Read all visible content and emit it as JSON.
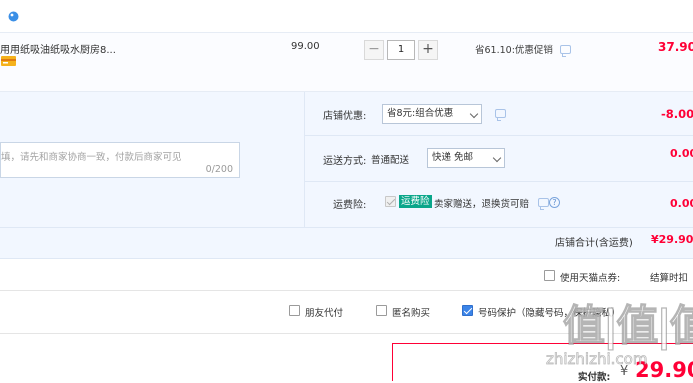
{
  "item": {
    "title": "用用纸吸油纸吸水厨房8...",
    "unit_price": "99.00",
    "quantity": "1",
    "minus_symbol": "−",
    "plus_symbol": "+",
    "promo_text": "省61.10:优惠促销",
    "subtotal": "37.90"
  },
  "shop": {
    "message_placeholder": "填，请先和商家协商一致，付款后商家可见",
    "message_counter": "0/200",
    "discount_label": "店铺优惠:",
    "discount_select": "省8元:组合优惠",
    "discount_amount": "-8.00",
    "delivery_label": "运送方式:",
    "delivery_type": "普通配送",
    "delivery_select": "快递 免邮",
    "delivery_amount": "0.00",
    "insurance_label": "运费险:",
    "insurance_badge": "运费险",
    "insurance_text": "卖家赠送，退换货可赔",
    "insurance_amount": "0.00",
    "total_label": "店铺合计(含运费)",
    "total_amount": "¥29.90"
  },
  "coupon": {
    "label": "使用天猫点券:",
    "settle_text": "结算时扣"
  },
  "options": {
    "friend_pay": "朋友代付",
    "anonymous": "匿名购买",
    "number_protect": "号码保护（隐藏号码，保护隐私）"
  },
  "payment": {
    "label": "实付款:",
    "currency": "¥",
    "amount": "29.90"
  },
  "watermark": {
    "logo_text": "值|值|值",
    "url_text": "zhizhizhi.com"
  },
  "colors": {
    "price_red": "#ff0036",
    "accent_blue": "#3b84e8",
    "panel_bg": "#f2f7ff"
  }
}
